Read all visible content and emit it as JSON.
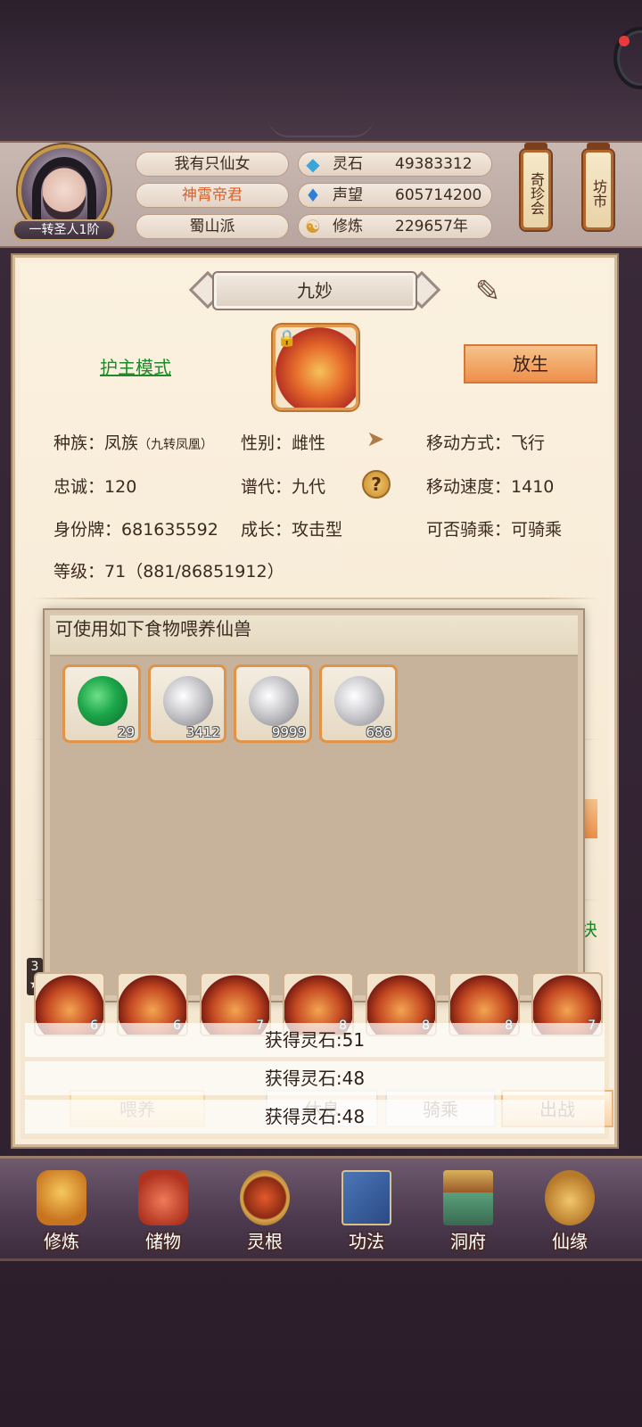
{
  "header": {
    "rank": "一转圣人1阶",
    "player_name": "我有只仙女",
    "title": "神霄帝君",
    "sect": "蜀山派",
    "resources": [
      {
        "icon": "spirit-stone-icon",
        "label": "灵石",
        "value": "49383312"
      },
      {
        "icon": "prestige-icon",
        "label": "声望",
        "value": "605714200"
      },
      {
        "icon": "cultivation-icon",
        "label": "修炼",
        "value": "229657年"
      }
    ],
    "shortcuts": [
      "奇珍会",
      "坊市"
    ]
  },
  "pet": {
    "name": "九妙",
    "mode_link": "护主模式",
    "release_label": "放生",
    "attributes": {
      "race_label": "种族：",
      "race_value": "凤族",
      "race_sub": "（九转凤凰）",
      "gender_label": "性别：",
      "gender_value": "雌性",
      "move_type_label": "移动方式：",
      "move_type_value": "飞行",
      "loyalty_label": "忠诚：",
      "loyalty_value": "120",
      "generation_label": "谱代：",
      "generation_value": "九代",
      "move_speed_label": "移动速度：",
      "move_speed_value": "1410",
      "id_label": "身份牌：",
      "id_value": "681635592",
      "growth_label": "成长：",
      "growth_value": "攻击型",
      "rideable_label": "可否骑乘：",
      "rideable_value": "可骑乘",
      "level_label": "等级：",
      "level_value": "71（881/86851912）"
    }
  },
  "food_popup": {
    "title": "可使用如下食物喂养仙兽",
    "items": [
      {
        "icon": "green-jade-orb-icon",
        "count": "29"
      },
      {
        "icon": "silver-phoenix-orb-icon",
        "count": "3412"
      },
      {
        "icon": "silver-phoenix-orb-icon",
        "count": "9999"
      },
      {
        "icon": "silver-swirl-orb-icon",
        "count": "686"
      }
    ]
  },
  "pet_strip": {
    "star_count": "3",
    "side_text": "块",
    "levels": [
      "6",
      "6",
      "7",
      "8",
      "8",
      "8",
      "7"
    ]
  },
  "toasts": [
    "获得灵石:51",
    "获得灵石:48",
    "获得灵石:48"
  ],
  "actions": {
    "feed": "喂养",
    "rest": "休息",
    "ride": "骑乘",
    "battle": "出战"
  },
  "bottom_nav": [
    {
      "label": "修炼",
      "icon": "cultivate-monk-icon"
    },
    {
      "label": "储物",
      "icon": "storage-bag-icon"
    },
    {
      "label": "灵根",
      "icon": "spirit-root-icon"
    },
    {
      "label": "功法",
      "icon": "skill-book-icon"
    },
    {
      "label": "洞府",
      "icon": "cave-mansion-icon"
    },
    {
      "label": "仙缘",
      "icon": "immortal-fate-icon"
    }
  ],
  "colors": {
    "accent_orange": "#ee8f4b",
    "link_green": "#1f8a2a",
    "title_orange": "#d9622a"
  }
}
